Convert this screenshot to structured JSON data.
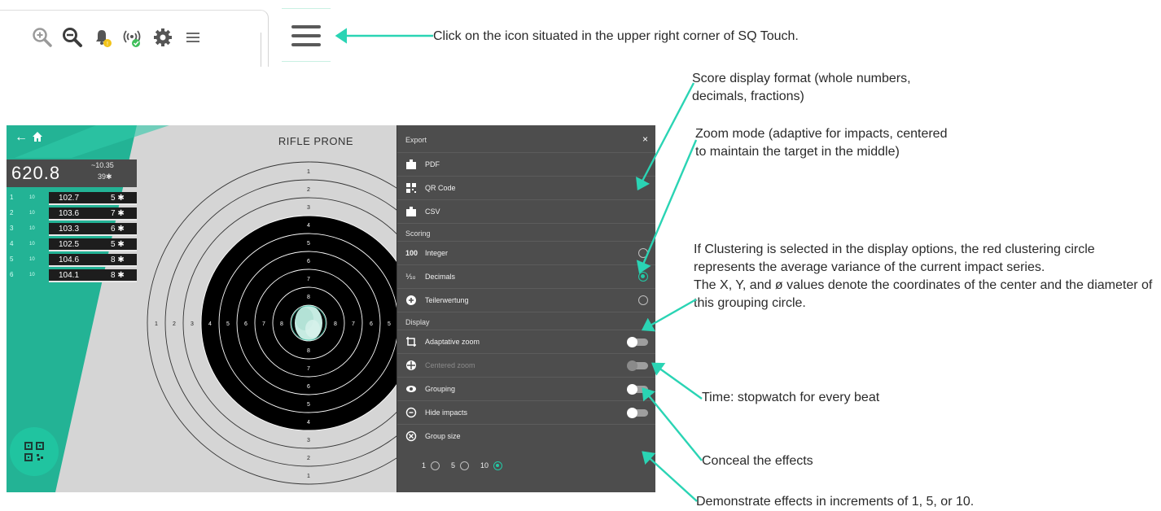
{
  "toolbar": {
    "icons": [
      "zoom-in-icon",
      "zoom-out-icon",
      "bell-warning-icon",
      "wifi-connected-icon",
      "gear-icon",
      "menu-icon"
    ],
    "menu_button_icon": "hamburger-menu-icon"
  },
  "annotations": {
    "menu": "Click on the icon situated in the upper right corner of SQ Touch.",
    "score_format": "Score display format (whole numbers, decimals, fractions)",
    "zoom_mode": "Zoom mode (adaptive for impacts, centered to maintain the target in the middle)",
    "clustering_1": "If Clustering is selected in the display options, the red clustering circle represents the average variance of the current impact series.",
    "clustering_2": "The X, Y, and ø values denote the coordinates of the center and the diameter of this grouping circle.",
    "time": "Time: stopwatch for every beat",
    "conceal": "Conceal the effects",
    "demonstrate": "Demonstrate effects in increments of 1, 5, or 10."
  },
  "app": {
    "title": "RIFLE PRONE",
    "back": "←",
    "total_score": "620.8",
    "avg": "~10.35",
    "inner_tens": "39✱",
    "series": [
      {
        "idx": "1",
        "shots": "10",
        "score": "102.7",
        "inner": "5 ✱"
      },
      {
        "idx": "2",
        "shots": "10",
        "score": "103.6",
        "inner": "7 ✱"
      },
      {
        "idx": "3",
        "shots": "10",
        "score": "103.3",
        "inner": "6 ✱"
      },
      {
        "idx": "4",
        "shots": "10",
        "score": "102.5",
        "inner": "5 ✱"
      },
      {
        "idx": "5",
        "shots": "10",
        "score": "104.6",
        "inner": "8 ✱"
      },
      {
        "idx": "6",
        "shots": "10",
        "score": "104.1",
        "inner": "8 ✱"
      }
    ],
    "ring_numbers": [
      "1",
      "2",
      "3",
      "4",
      "5",
      "6",
      "7",
      "8"
    ]
  },
  "panel": {
    "export_title": "Export",
    "close": "×",
    "export_items": [
      "PDF",
      "QR Code",
      "CSV"
    ],
    "scoring_title": "Scoring",
    "scoring": {
      "integer_prefix": "100",
      "integer_label": "Integer",
      "decimals_prefix": "⅒",
      "decimals_label": "Decimals",
      "teiler_label": "Teilerwertung"
    },
    "display_title": "Display",
    "display_items": [
      "Adaptative zoom",
      "Centered zoom",
      "Grouping",
      "Hide impacts",
      "Group size"
    ],
    "group_sizes": [
      "1",
      "5",
      "10"
    ],
    "selected_group_size": "10",
    "selected_scoring": "Decimals"
  },
  "colors": {
    "accent": "#22c9a6",
    "arrow": "#2ad4b4",
    "panel": "#4d4d4d",
    "target_black": "#000000"
  }
}
